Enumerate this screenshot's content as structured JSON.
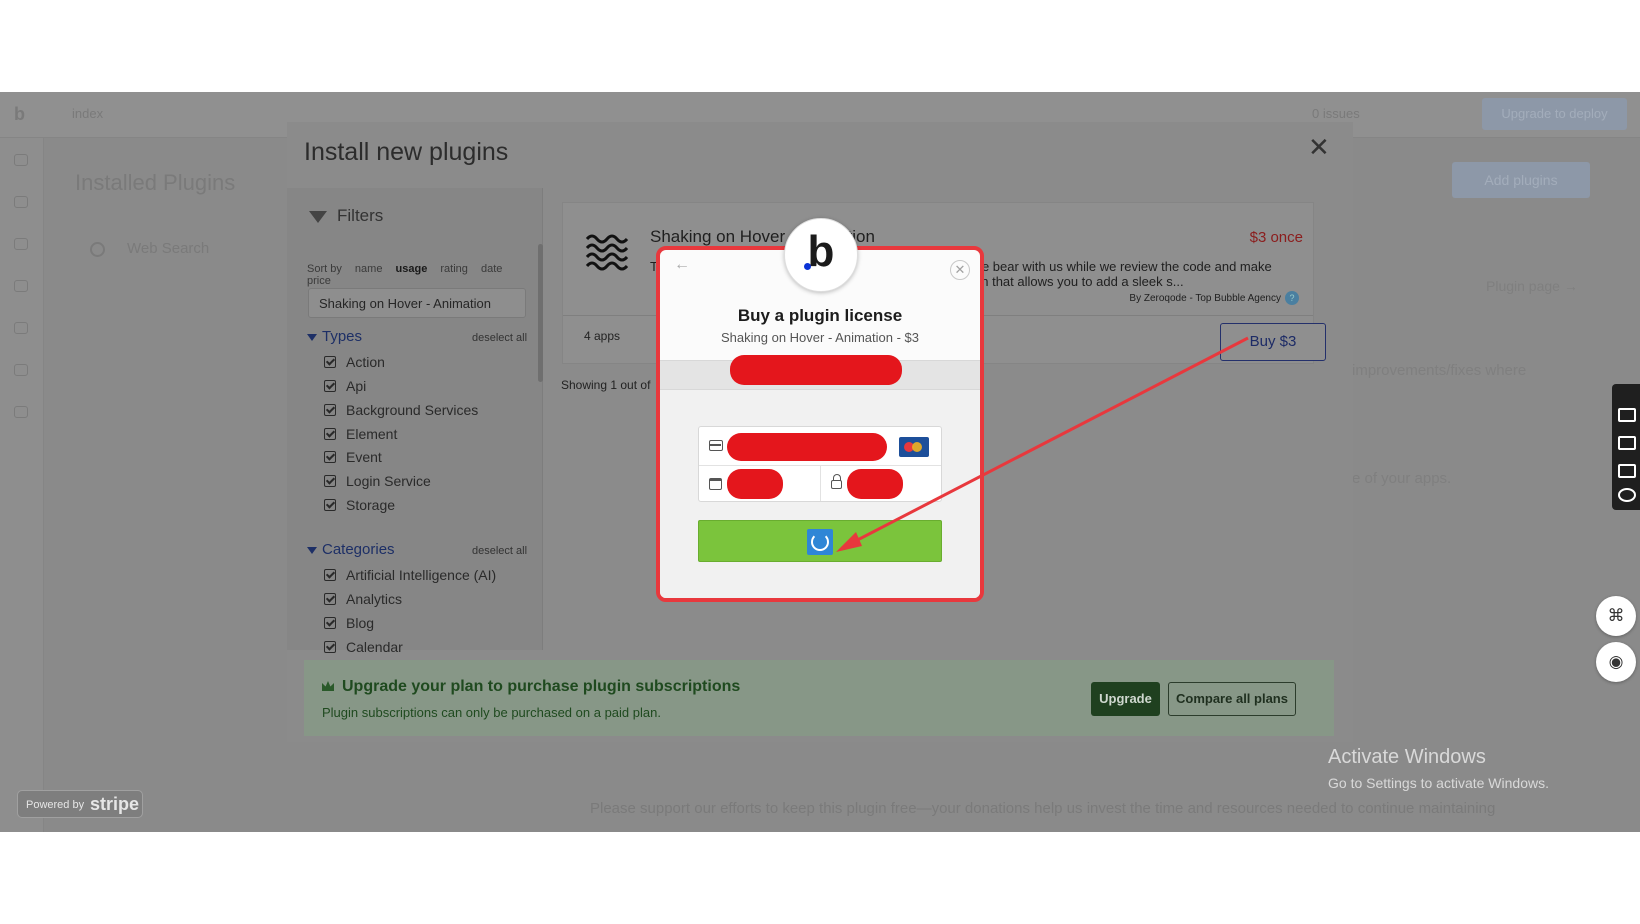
{
  "editor": {
    "page_name": "index",
    "issues": "0 issues",
    "deploy_label": "Upgrade to deploy",
    "installed_title": "Installed Plugins",
    "search_placeholder": "Web Search",
    "add_plugins": "Add plugins",
    "plugin_page": "Plugin page →",
    "bg_text_1": "improvements/fixes where",
    "bg_text_2": "e of your apps.",
    "donate": "Please support our efforts to keep this plugin free—your donations help us invest the time and resources needed to continue maintaining"
  },
  "install_panel": {
    "title": "Install new plugins",
    "filters_label": "Filters",
    "sort_label": "Sort by",
    "sort_options": [
      "name",
      "usage",
      "rating",
      "date",
      "price"
    ],
    "sort_active": "usage",
    "search_value": "Shaking on Hover - Animation",
    "types_label": "Types",
    "types_deselect": "deselect all",
    "types": [
      "Action",
      "Api",
      "Background Services",
      "Element",
      "Event",
      "Login Service",
      "Storage"
    ],
    "categories_label": "Categories",
    "categories_deselect": "deselect all",
    "categories": [
      "Artificial Intelligence (AI)",
      "Analytics",
      "Blog",
      "Calendar"
    ],
    "showing": "Showing 1 out of"
  },
  "plugin_card": {
    "title": "Shaking on Hover - Animation",
    "price": "$3 once",
    "desc_left": "T",
    "desc_right_1": "ease bear with us while we review the code and make",
    "desc_right_2": "lugin that allows you to add a sleek s...",
    "author": "By Zeroqode - Top Bubble Agency",
    "apps": "4 apps",
    "buy_label": "Buy $3"
  },
  "upgrade_banner": {
    "title": "Upgrade your plan to purchase plugin subscriptions",
    "subtitle": "Plugin subscriptions can only be purchased on a paid plan.",
    "upgrade_label": "Upgrade",
    "compare_label": "Compare all plans"
  },
  "stripe_modal": {
    "title": "Buy a plugin license",
    "subtitle": "Shaking on Hover - Animation - $3",
    "logo_letter": "b"
  },
  "stripe_badge": {
    "powered": "Powered by",
    "brand": "stripe"
  },
  "windows": {
    "line1": "Activate Windows",
    "line2": "Go to Settings to activate Windows."
  },
  "colors": {
    "redaction": "#e4161c",
    "modal_border": "#e8383d",
    "pay_button": "#7bc43c",
    "arrow": "#e8383d"
  }
}
